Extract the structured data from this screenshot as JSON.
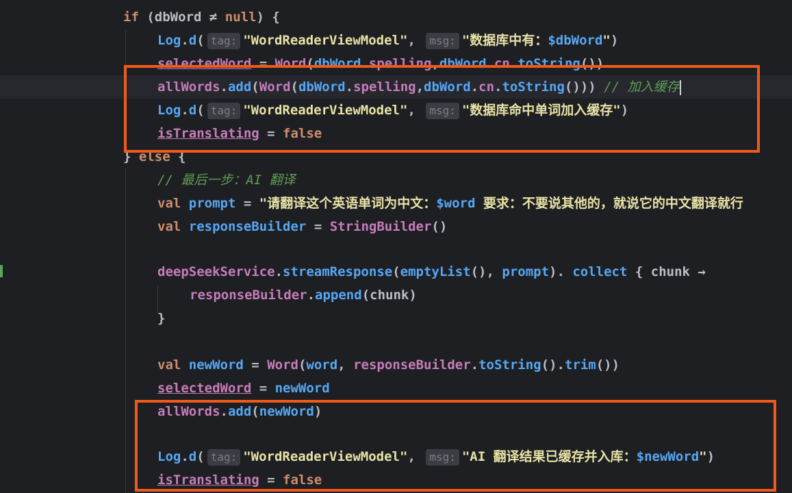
{
  "editor": {
    "lines": [
      {
        "id": "l1",
        "indent": 180,
        "tokens": [
          [
            "kw",
            "if"
          ],
          [
            "pl",
            " ("
          ],
          [
            "pl",
            "dbWord"
          ],
          [
            "pl",
            " ≠ "
          ],
          [
            "kw",
            "null"
          ],
          [
            "pl",
            ") {"
          ]
        ]
      },
      {
        "id": "l2",
        "indent": 230,
        "tokens": [
          [
            "fn",
            "Log"
          ],
          [
            "pl",
            "."
          ],
          [
            "fn",
            "d"
          ],
          [
            "pl",
            "("
          ],
          [
            "hint",
            "tag:"
          ],
          [
            "str",
            "\"WordReaderViewModel\""
          ],
          [
            "pl",
            ", "
          ],
          [
            "hint",
            "msg:"
          ],
          [
            "str",
            "\"数据库中有："
          ],
          [
            "fn",
            "$dbWord"
          ],
          [
            "str",
            "\""
          ],
          [
            "pl",
            ")"
          ]
        ]
      },
      {
        "id": "l3",
        "indent": 230,
        "tokens": [
          [
            "var strike uline",
            "selectedWord"
          ],
          [
            "pl",
            " = "
          ],
          [
            "cls",
            "Word"
          ],
          [
            "pl",
            "("
          ],
          [
            "fn",
            "dbWord"
          ],
          [
            "pl",
            "."
          ],
          [
            "prop",
            "spelling"
          ],
          [
            "pl",
            ","
          ],
          [
            "fn",
            "dbWord"
          ],
          [
            "pl",
            "."
          ],
          [
            "prop",
            "cn"
          ],
          [
            "pl",
            "."
          ],
          [
            "fn",
            "toString"
          ],
          [
            "pl",
            "())"
          ]
        ]
      },
      {
        "id": "l4",
        "indent": 230,
        "tokens": [
          [
            "var",
            "allWords"
          ],
          [
            "pl",
            "."
          ],
          [
            "fn",
            "add"
          ],
          [
            "pl",
            "("
          ],
          [
            "cls",
            "Word"
          ],
          [
            "pl",
            "("
          ],
          [
            "fn",
            "dbWord"
          ],
          [
            "pl",
            "."
          ],
          [
            "prop",
            "spelling"
          ],
          [
            "pl",
            ","
          ],
          [
            "fn",
            "dbWord"
          ],
          [
            "pl",
            "."
          ],
          [
            "prop",
            "cn"
          ],
          [
            "pl",
            "."
          ],
          [
            "fn",
            "toString"
          ],
          [
            "pl",
            "())) "
          ],
          [
            "cm",
            "// 加入缓存"
          ]
        ]
      },
      {
        "id": "l5",
        "indent": 230,
        "tokens": [
          [
            "fn",
            "Log"
          ],
          [
            "pl",
            "."
          ],
          [
            "fn",
            "d"
          ],
          [
            "pl",
            "("
          ],
          [
            "hint",
            "tag:"
          ],
          [
            "str",
            "\"WordReaderViewModel\""
          ],
          [
            "pl",
            ", "
          ],
          [
            "hint",
            "msg:"
          ],
          [
            "str",
            "\"数据库命中单词加入缓存\""
          ],
          [
            "pl",
            ")"
          ]
        ]
      },
      {
        "id": "l6",
        "indent": 230,
        "tokens": [
          [
            "var uline",
            "isTranslating"
          ],
          [
            "pl",
            " = "
          ],
          [
            "kw",
            "false"
          ]
        ]
      },
      {
        "id": "l7",
        "indent": 180,
        "tokens": [
          [
            "pl",
            "} "
          ],
          [
            "kw",
            "else"
          ],
          [
            "pl",
            " {"
          ]
        ]
      },
      {
        "id": "l8",
        "indent": 230,
        "tokens": [
          [
            "cm",
            "// 最后一步：AI 翻译"
          ]
        ]
      },
      {
        "id": "l9",
        "indent": 230,
        "tokens": [
          [
            "kw",
            "val"
          ],
          [
            "pl",
            " "
          ],
          [
            "fn",
            "prompt"
          ],
          [
            "pl",
            " = "
          ],
          [
            "str",
            "\"请翻译这个英语单词为中文："
          ],
          [
            "fn",
            "$word"
          ],
          [
            "str",
            " 要求：不要说其他的，就说它的中文翻译就行"
          ]
        ]
      },
      {
        "id": "l10",
        "indent": 230,
        "tokens": [
          [
            "kw",
            "val"
          ],
          [
            "pl",
            " "
          ],
          [
            "fn",
            "responseBuilder"
          ],
          [
            "pl",
            " = "
          ],
          [
            "cls",
            "StringBuilder"
          ],
          [
            "pl",
            "()"
          ]
        ]
      },
      {
        "id": "l11",
        "indent": 230,
        "tokens": []
      },
      {
        "id": "l12",
        "indent": 230,
        "tokens": [
          [
            "var",
            "deepSeekService"
          ],
          [
            "pl",
            "."
          ],
          [
            "fn",
            "streamResponse"
          ],
          [
            "pl",
            "("
          ],
          [
            "fn",
            "emptyList"
          ],
          [
            "pl",
            "(), "
          ],
          [
            "fn",
            "prompt"
          ],
          [
            "pl",
            "). "
          ],
          [
            "fn",
            "collect"
          ],
          [
            "pl",
            " { "
          ],
          [
            "pl",
            "chunk"
          ],
          [
            "pl",
            " →"
          ]
        ]
      },
      {
        "id": "l13",
        "indent": 277,
        "tokens": [
          [
            "var",
            "responseBuilder"
          ],
          [
            "pl",
            "."
          ],
          [
            "fn",
            "append"
          ],
          [
            "pl",
            "("
          ],
          [
            "pl",
            "chunk"
          ],
          [
            "pl",
            ")"
          ]
        ]
      },
      {
        "id": "l14",
        "indent": 230,
        "tokens": [
          [
            "pl",
            "}"
          ]
        ]
      },
      {
        "id": "l15",
        "indent": 230,
        "tokens": []
      },
      {
        "id": "l16",
        "indent": 230,
        "tokens": [
          [
            "kw",
            "val"
          ],
          [
            "pl",
            " "
          ],
          [
            "fn",
            "newWord"
          ],
          [
            "pl",
            " = "
          ],
          [
            "cls",
            "Word"
          ],
          [
            "pl",
            "("
          ],
          [
            "fn",
            "word"
          ],
          [
            "pl",
            ", "
          ],
          [
            "var",
            "responseBuilder"
          ],
          [
            "pl",
            "."
          ],
          [
            "fn",
            "toString"
          ],
          [
            "pl",
            "()."
          ],
          [
            "fn",
            "trim"
          ],
          [
            "pl",
            "())"
          ]
        ]
      },
      {
        "id": "l17",
        "indent": 230,
        "tokens": [
          [
            "var uline",
            "selectedWord"
          ],
          [
            "pl",
            " = "
          ],
          [
            "fn",
            "newWord"
          ]
        ]
      },
      {
        "id": "l18",
        "indent": 230,
        "tokens": [
          [
            "var",
            "allWords"
          ],
          [
            "pl",
            "."
          ],
          [
            "fn",
            "add"
          ],
          [
            "pl",
            "("
          ],
          [
            "fn",
            "newWord"
          ],
          [
            "pl",
            ")"
          ]
        ]
      },
      {
        "id": "l19",
        "indent": 230,
        "tokens": []
      },
      {
        "id": "l20",
        "indent": 230,
        "tokens": [
          [
            "fn",
            "Log"
          ],
          [
            "pl",
            "."
          ],
          [
            "fn",
            "d"
          ],
          [
            "pl",
            "("
          ],
          [
            "hint",
            "tag:"
          ],
          [
            "str",
            "\"WordReaderViewModel\""
          ],
          [
            "pl",
            ", "
          ],
          [
            "hint",
            "msg:"
          ],
          [
            "str",
            "\"AI 翻译结果已缓存并入库："
          ],
          [
            "fn",
            "$newWord"
          ],
          [
            "str",
            "\""
          ],
          [
            "pl",
            ")"
          ]
        ]
      },
      {
        "id": "l21",
        "indent": 230,
        "tokens": [
          [
            "var uline",
            "isTranslating"
          ],
          [
            "pl",
            " = "
          ],
          [
            "kw",
            "false"
          ]
        ]
      }
    ]
  },
  "colors": {
    "background": "#1e1f22",
    "highlight_box": "#f05a1a",
    "current_line": "#26282e"
  },
  "icons": {
    "gutter_bulb": "lightbulb-icon"
  }
}
